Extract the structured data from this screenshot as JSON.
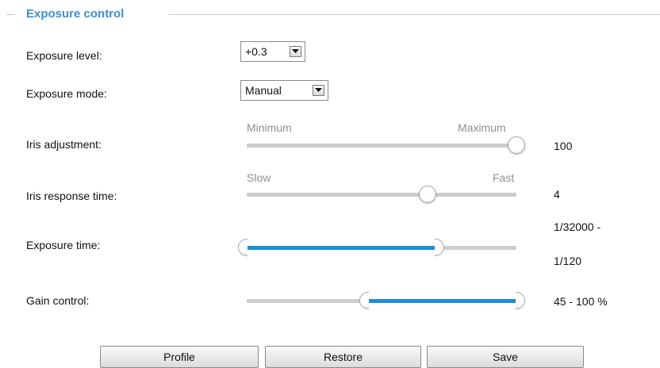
{
  "section": {
    "title": "Exposure control"
  },
  "exposure_level": {
    "label": "Exposure level:",
    "selected": "+0.3"
  },
  "exposure_mode": {
    "label": "Exposure mode:",
    "selected": "Manual"
  },
  "iris_adjustment": {
    "label": "Iris adjustment:",
    "min_label": "Minimum",
    "max_label": "Maximum",
    "value": "100",
    "level_fraction": 1.0
  },
  "iris_response": {
    "label": "Iris response time:",
    "min_label": "Slow",
    "max_label": "Fast",
    "value": "4",
    "level_fraction": 0.67
  },
  "exposure_time": {
    "label": "Exposure time:",
    "value_line1": "1/32000 -",
    "value_line2": "1/120",
    "range_fraction": [
      0.0,
      0.7
    ]
  },
  "gain_control": {
    "label": "Gain control:",
    "value": "45 - 100 %",
    "range_fraction": [
      0.45,
      1.0
    ]
  },
  "buttons": {
    "profile": "Profile",
    "restore": "Restore",
    "save": "Save"
  },
  "colors": {
    "accent": "#3a8fd3",
    "slider_fill": "#1a8fd8",
    "track": "#cdcdcd"
  },
  "icons": {
    "select_arrow": "chevron-down-icon"
  }
}
